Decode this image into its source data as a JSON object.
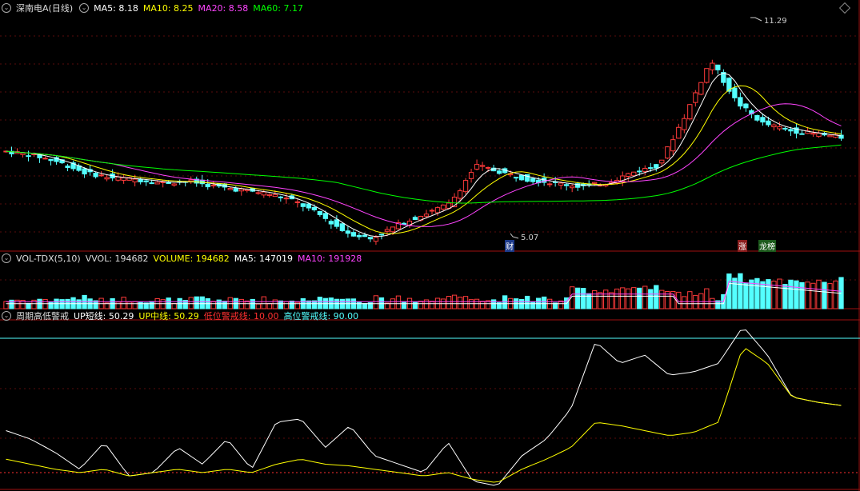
{
  "header": {
    "stock_name": "深南电A(日线)",
    "ma5": "MA5: 8.18",
    "ma10": "MA10: 8.25",
    "ma20": "MA20: 8.58",
    "ma60": "MA60: 7.17"
  },
  "volume_header": {
    "indicator": "VOL-TDX(5,10)",
    "vvol": "VVOL: 194682",
    "volume": "VOLUME: 194682",
    "ma5": "MA5: 147019",
    "ma10": "MA10: 191928"
  },
  "osc_header": {
    "indicator": "周期高低警戒",
    "up_short": "UP短线: 50.29",
    "up_mid": "UP中线: 50.29",
    "low_alert": "低位警戒线: 10.00",
    "high_alert": "高位警戒线: 90.00"
  },
  "annotations": {
    "high_price": "11.29",
    "low_price": "5.07",
    "tag_cai": "财",
    "tag_zhang": "涨",
    "tag_longhu": "龙榜"
  },
  "colors": {
    "up": "#ff3a3a",
    "down": "#54ffff",
    "ma5": "#ffffff",
    "ma10": "#ffff00",
    "ma20": "#ff44ff",
    "ma60": "#00ff00",
    "low_alert": "#ff3030",
    "high_alert": "#54ffff"
  },
  "chart_data": [
    {
      "type": "candlestick",
      "title": "深南电A(日线)",
      "price_extremes": {
        "high": 11.29,
        "low": 5.07
      },
      "indicators": {
        "MA5": 8.18,
        "MA10": 8.25,
        "MA20": 8.58,
        "MA60": 7.17
      },
      "close_trend_keypoints": [
        7.6,
        7.5,
        7.3,
        7.0,
        6.85,
        6.8,
        6.7,
        6.75,
        6.6,
        6.5,
        6.4,
        6.2,
        5.8,
        5.3,
        5.1,
        5.5,
        5.8,
        6.1,
        7.2,
        7.0,
        6.8,
        6.7,
        6.6,
        6.7,
        7.0,
        7.2,
        8.6,
        10.2,
        9.0,
        8.4,
        8.2,
        8.1,
        8.0
      ]
    },
    {
      "type": "bar",
      "title": "VOL-TDX(5,10)",
      "indicators": {
        "VVOL": 194682,
        "VOLUME": 194682,
        "MA5": 147019,
        "MA10": 191928
      }
    },
    {
      "type": "line",
      "title": "周期高低警戒",
      "ylim": [
        0,
        100
      ],
      "alert_lines": {
        "low": 10.0,
        "high": 90.0
      },
      "series": [
        {
          "name": "UP短线",
          "last": 50.29,
          "trend_keypoints": [
            35,
            30,
            22,
            12,
            28,
            8,
            10,
            25,
            15,
            30,
            12,
            40,
            42,
            25,
            38,
            20,
            15,
            10,
            28,
            5,
            2,
            20,
            30,
            48,
            88,
            75,
            80,
            68,
            70,
            75,
            97,
            80,
            55,
            52,
            50
          ]
        },
        {
          "name": "UP中线",
          "last": 50.29,
          "trend_keypoints": [
            18,
            15,
            12,
            10,
            12,
            8,
            10,
            12,
            10,
            12,
            10,
            15,
            18,
            15,
            14,
            12,
            10,
            8,
            10,
            6,
            4,
            12,
            18,
            25,
            40,
            38,
            35,
            32,
            34,
            40,
            85,
            75,
            55,
            52,
            50
          ]
        }
      ]
    }
  ]
}
